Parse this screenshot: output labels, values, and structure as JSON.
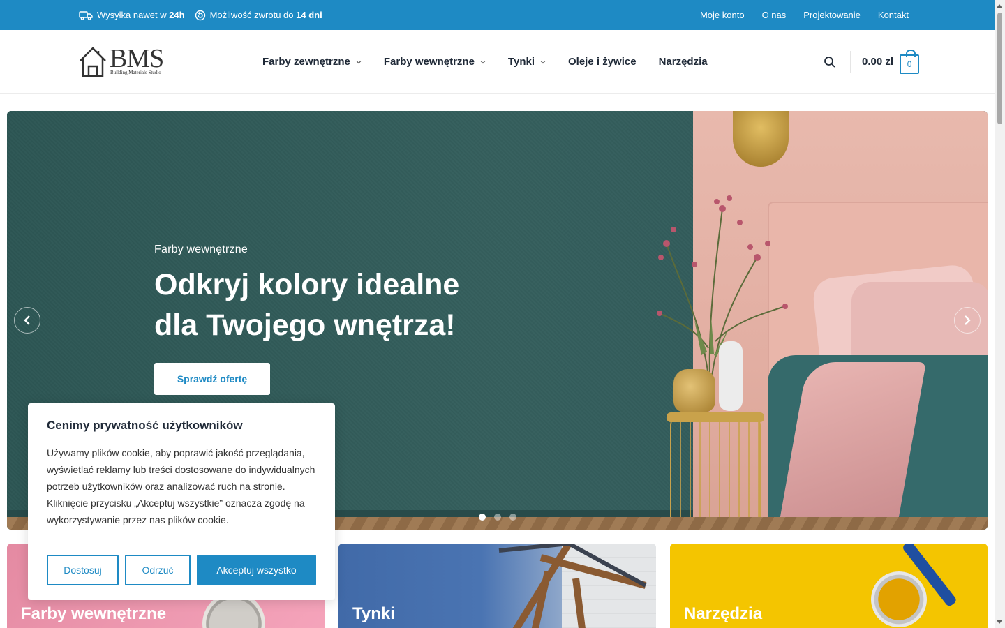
{
  "topbar": {
    "shipping_prefix": "Wysyłka nawet w ",
    "shipping_bold": "24h",
    "returns_prefix": "Możliwość zwrotu do ",
    "returns_bold": "14 dni",
    "links": [
      "Moje konto",
      "O nas",
      "Projektowanie",
      "Kontakt"
    ],
    "bg_color": "#1e8ac4"
  },
  "header": {
    "logo": {
      "brand": "BMS",
      "tagline": "Building Materials Studio"
    },
    "nav": [
      {
        "label": "Farby zewnętrzne",
        "has_dropdown": true
      },
      {
        "label": "Farby wewnętrzne",
        "has_dropdown": true
      },
      {
        "label": "Tynki",
        "has_dropdown": true
      },
      {
        "label": "Oleje i żywice",
        "has_dropdown": false
      },
      {
        "label": "Narzędzia",
        "has_dropdown": false
      }
    ],
    "search_icon": "search-icon",
    "cart": {
      "total": "0.00 zł",
      "count": "0"
    }
  },
  "hero": {
    "eyebrow": "Farby wewnętrzne",
    "title_line1": "Odkryj kolory idealne",
    "title_line2": "dla Twojego wnętrza!",
    "cta_label": "Sprawdź ofertę",
    "slides_total": 3,
    "active_slide": 1
  },
  "categories": [
    {
      "label": "Farby wewnętrzne"
    },
    {
      "label": "Tynki"
    },
    {
      "label": "Narzędzia"
    }
  ],
  "cookie": {
    "title": "Cenimy prywatność użytkowników",
    "body": "Używamy plików cookie, aby poprawić jakość przeglądania, wyświetlać reklamy lub treści dostosowane do indywidualnych potrzeb użytkowników oraz analizować ruch na stronie. Kliknięcie przycisku „Akceptuj wszystkie” oznacza zgodę na wykorzystywanie przez nas plików cookie.",
    "btn_customize": "Dostosuj",
    "btn_reject": "Odrzuć",
    "btn_accept": "Akceptuj wszystko"
  },
  "colors": {
    "accent": "#1e8ac4",
    "hero_wall": "#2f5a58"
  }
}
